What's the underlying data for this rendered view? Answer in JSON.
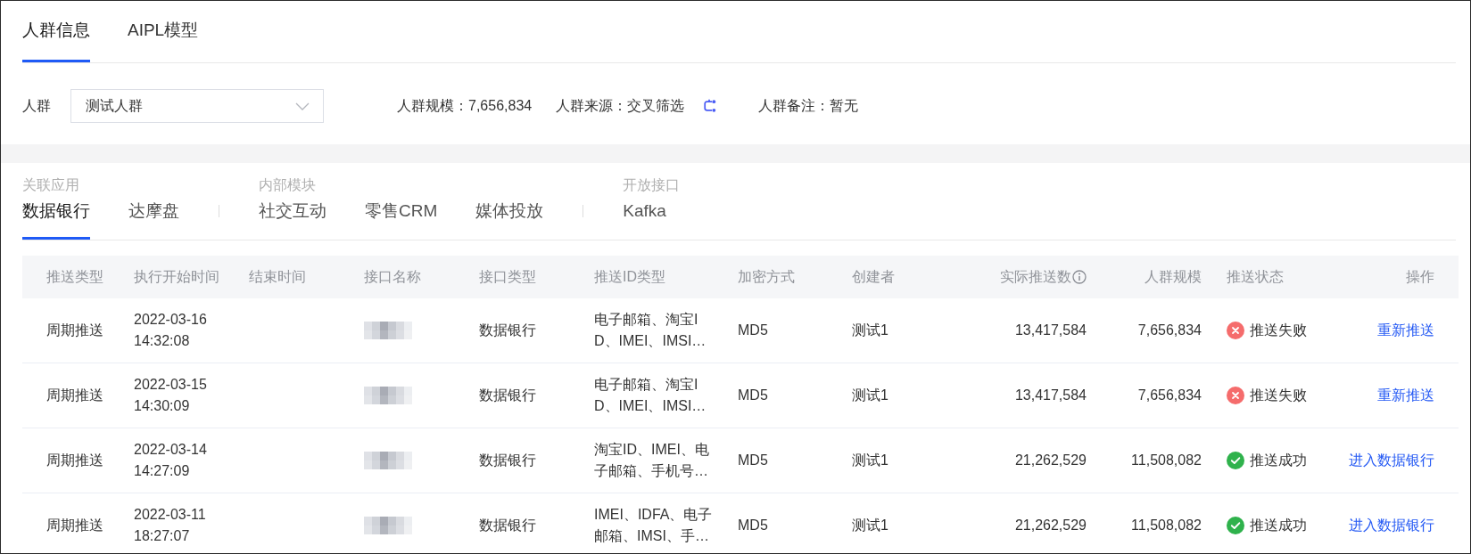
{
  "top_tabs": [
    {
      "label": "人群信息",
      "selected": true
    },
    {
      "label": "AIPL模型",
      "selected": false
    }
  ],
  "audience_filter": {
    "label": "人群",
    "select": {
      "value": "测试人群"
    },
    "info": [
      {
        "label": "人群规模：",
        "value": "7,656,834",
        "link_icon": false
      },
      {
        "label": "人群来源：",
        "value": "交叉筛选",
        "link_icon": true
      },
      {
        "label": "人群备注：",
        "value": "暂无",
        "link_icon": false
      }
    ]
  },
  "app_tab_groups": [
    {
      "label": "关联应用",
      "tabs": [
        {
          "label": "数据银行",
          "selected": true
        },
        {
          "label": "达摩盘",
          "selected": false
        }
      ]
    },
    {
      "label": "内部模块",
      "tabs": [
        {
          "label": "社交互动",
          "selected": false
        },
        {
          "label": "零售CRM",
          "selected": false
        },
        {
          "label": "媒体投放",
          "selected": false
        }
      ]
    },
    {
      "label": "开放接口",
      "tabs": [
        {
          "label": "Kafka",
          "selected": false
        }
      ]
    }
  ],
  "table": {
    "columns": [
      {
        "label": "推送类型",
        "info_icon": false
      },
      {
        "label": "执行开始时间",
        "info_icon": false
      },
      {
        "label": "结束时间",
        "info_icon": false
      },
      {
        "label": "接口名称",
        "info_icon": false
      },
      {
        "label": "接口类型",
        "info_icon": false
      },
      {
        "label": "推送ID类型",
        "info_icon": false
      },
      {
        "label": "加密方式",
        "info_icon": false
      },
      {
        "label": "创建者",
        "info_icon": false
      },
      {
        "label": "实际推送数",
        "info_icon": true
      },
      {
        "label": "人群规模",
        "info_icon": false
      },
      {
        "label": "推送状态",
        "info_icon": false
      },
      {
        "label": "操作",
        "info_icon": false
      }
    ],
    "rows": [
      {
        "push_type": "周期推送",
        "start_time": "2022-03-16 14:32:08",
        "interface_name_redacted": true,
        "interface_type": "数据银行",
        "id_types": "电子邮箱、淘宝ID、IMEI、IMSI…",
        "encryption": "MD5",
        "creator": "测试1",
        "actual_pushed": "13,417,584",
        "audience_size": "7,656,834",
        "status": {
          "kind": "failed",
          "label": "推送失败"
        },
        "action": "重新推送"
      },
      {
        "push_type": "周期推送",
        "start_time": "2022-03-15 14:30:09",
        "interface_name_redacted": true,
        "interface_type": "数据银行",
        "id_types": "电子邮箱、淘宝ID、IMEI、IMSI…",
        "encryption": "MD5",
        "creator": "测试1",
        "actual_pushed": "13,417,584",
        "audience_size": "7,656,834",
        "status": {
          "kind": "failed",
          "label": "推送失败"
        },
        "action": "重新推送"
      },
      {
        "push_type": "周期推送",
        "start_time": "2022-03-14 14:27:09",
        "interface_name_redacted": true,
        "interface_type": "数据银行",
        "id_types": "淘宝ID、IMEI、电子邮箱、手机号…",
        "encryption": "MD5",
        "creator": "测试1",
        "actual_pushed": "21,262,529",
        "audience_size": "11,508,082",
        "status": {
          "kind": "success",
          "label": "推送成功"
        },
        "action": "进入数据银行"
      },
      {
        "push_type": "周期推送",
        "start_time": "2022-03-11 18:27:07",
        "interface_name_redacted": true,
        "interface_type": "数据银行",
        "id_types": "IMEI、IDFA、电子邮箱、IMSI、手…",
        "encryption": "MD5",
        "creator": "测试1",
        "actual_pushed": "21,262,529",
        "audience_size": "11,508,082",
        "status": {
          "kind": "success",
          "label": "推送成功"
        },
        "action": "进入数据银行"
      }
    ]
  }
}
